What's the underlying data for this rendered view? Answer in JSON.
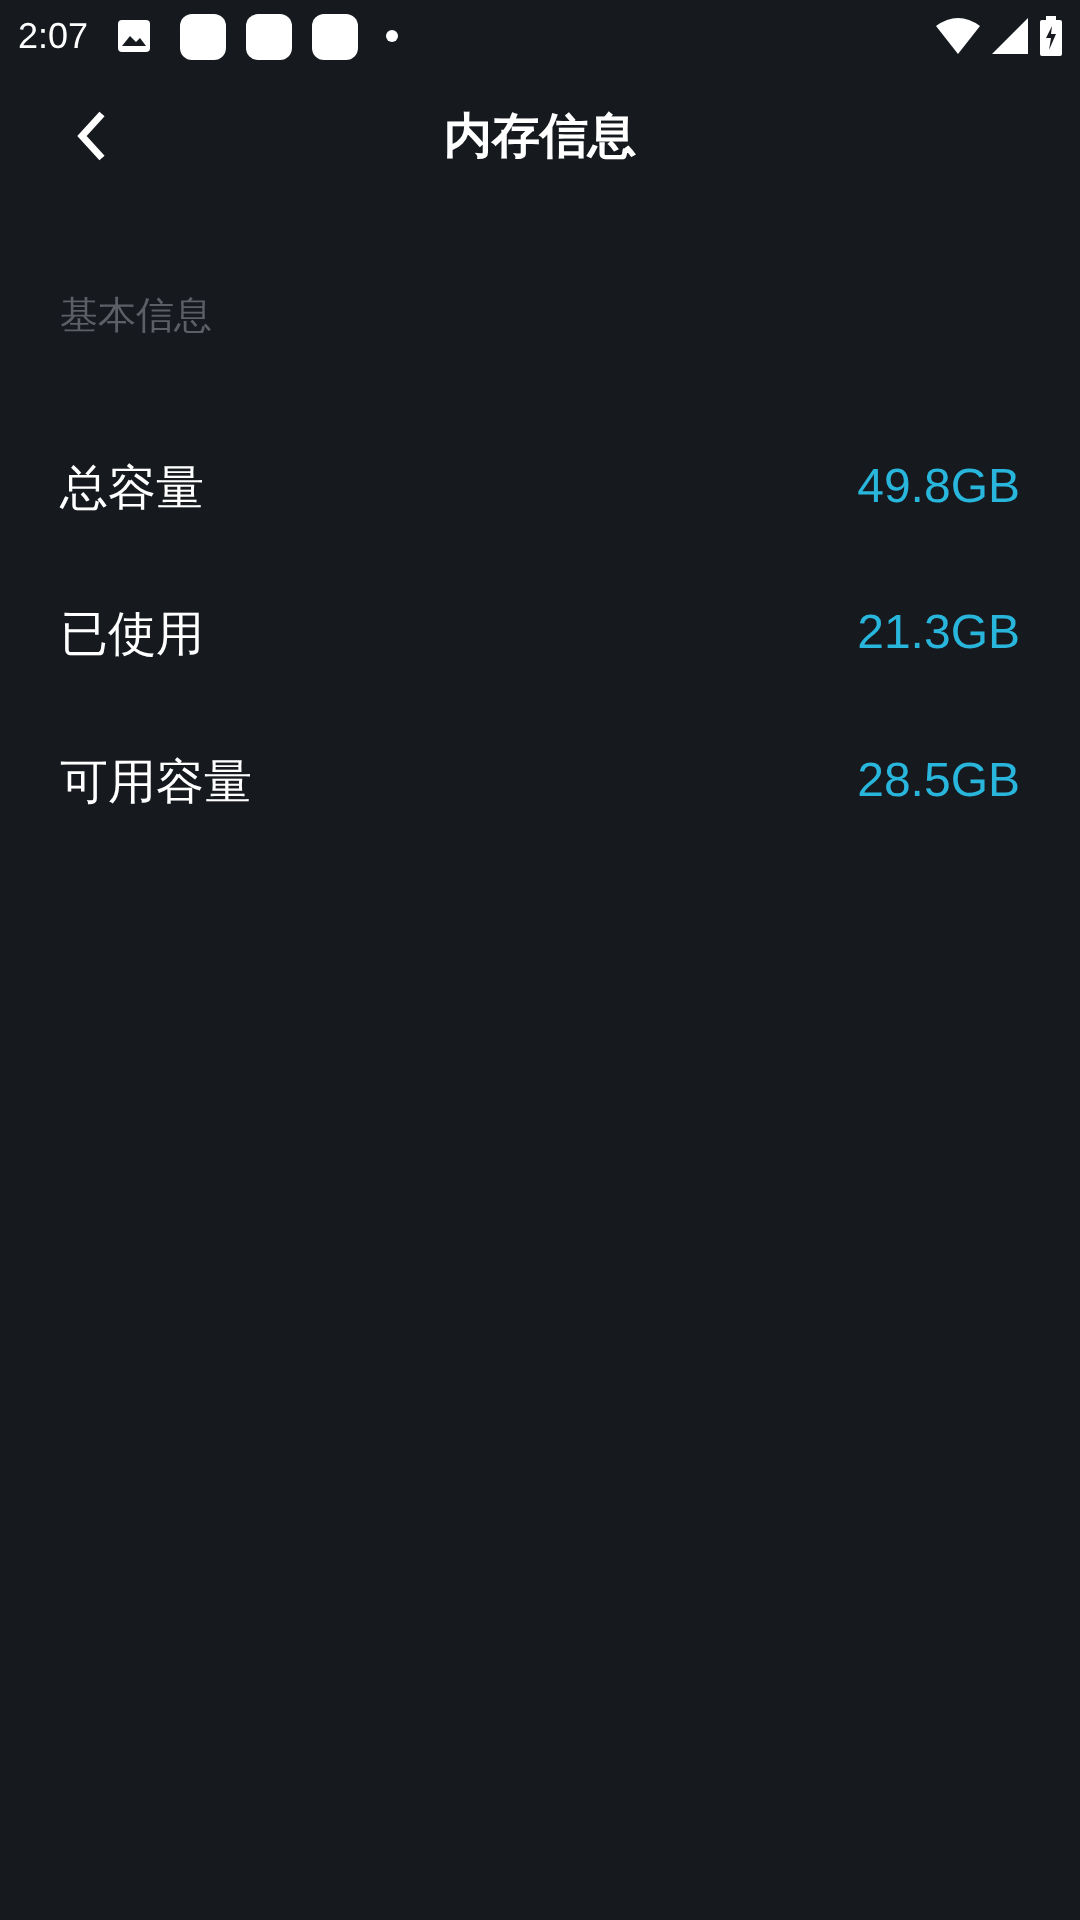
{
  "status_bar": {
    "time": "2:07"
  },
  "header": {
    "title": "内存信息"
  },
  "section": {
    "title": "基本信息"
  },
  "rows": [
    {
      "label": "总容量",
      "value": "49.8GB"
    },
    {
      "label": "已使用",
      "value": "21.3GB"
    },
    {
      "label": "可用容量",
      "value": "28.5GB"
    }
  ]
}
